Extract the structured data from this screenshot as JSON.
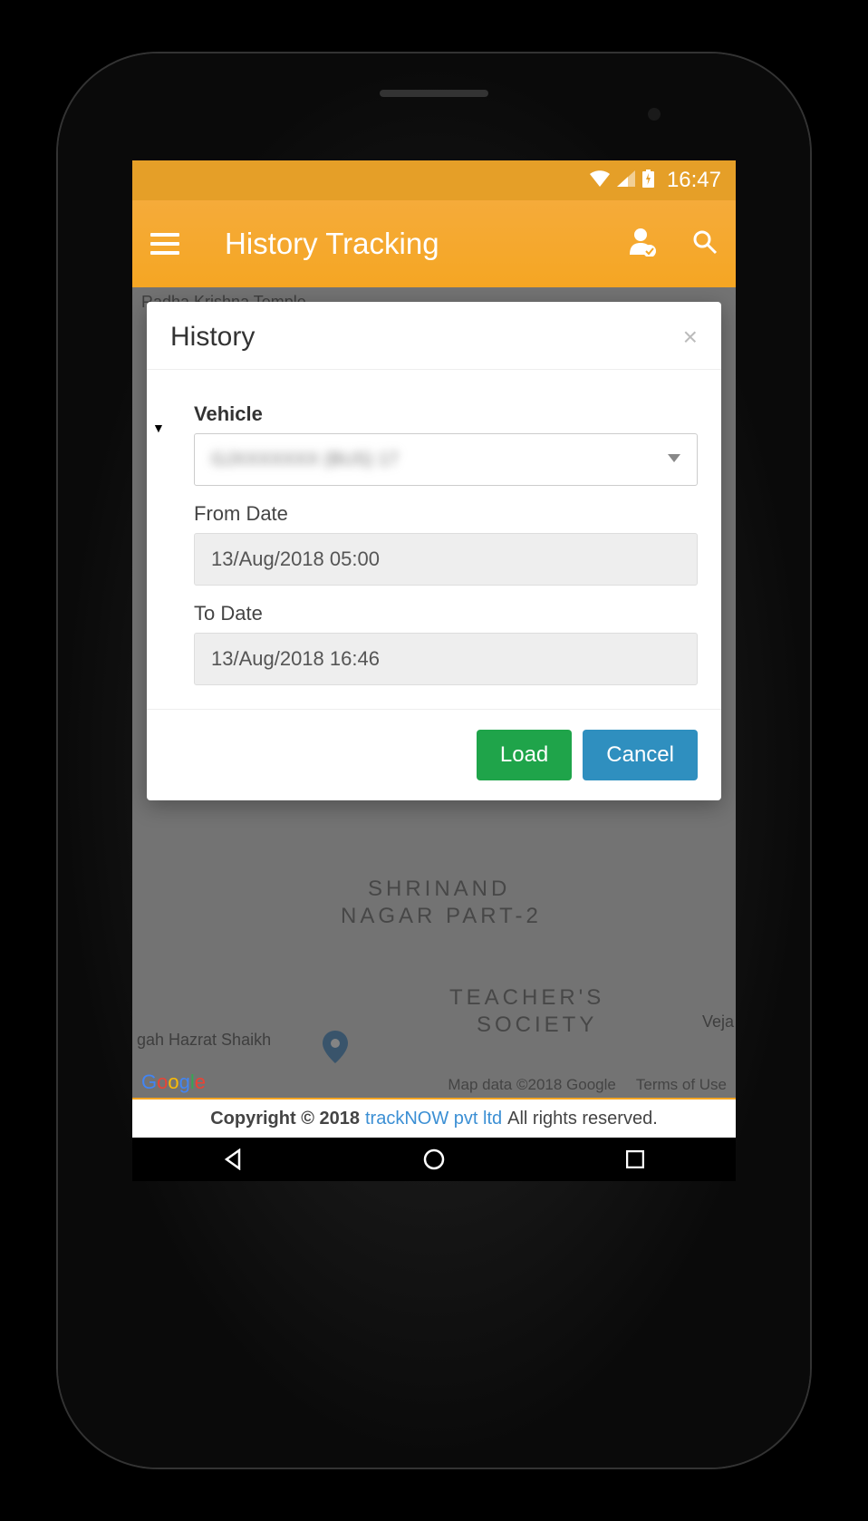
{
  "status": {
    "time": "16:47"
  },
  "appbar": {
    "title": "History Tracking"
  },
  "dialog": {
    "title": "History",
    "vehicle_label": "Vehicle",
    "vehicle_value": "GJXXXXXXX (BUS) 17",
    "from_label": "From Date",
    "from_value": "13/Aug/2018 05:00",
    "to_label": "To Date",
    "to_value": "13/Aug/2018 16:46",
    "load_label": "Load",
    "cancel_label": "Cancel"
  },
  "map": {
    "labels": {
      "shrinand1": "SHRINAND",
      "shrinand2": "NAGAR PART-2",
      "teachers1": "TEACHER'S",
      "teachers2": "SOCIETY",
      "veja": "Veja",
      "temple": "Radha Krishna Temple",
      "hazrat": "gah Hazrat Shaikh",
      "attr_data": "Map data ©2018 Google",
      "attr_terms": "Terms of Use"
    }
  },
  "footer": {
    "copyright": "Copyright © 2018",
    "brand": "trackNOW pvt ltd",
    "rights": "All rights reserved."
  }
}
